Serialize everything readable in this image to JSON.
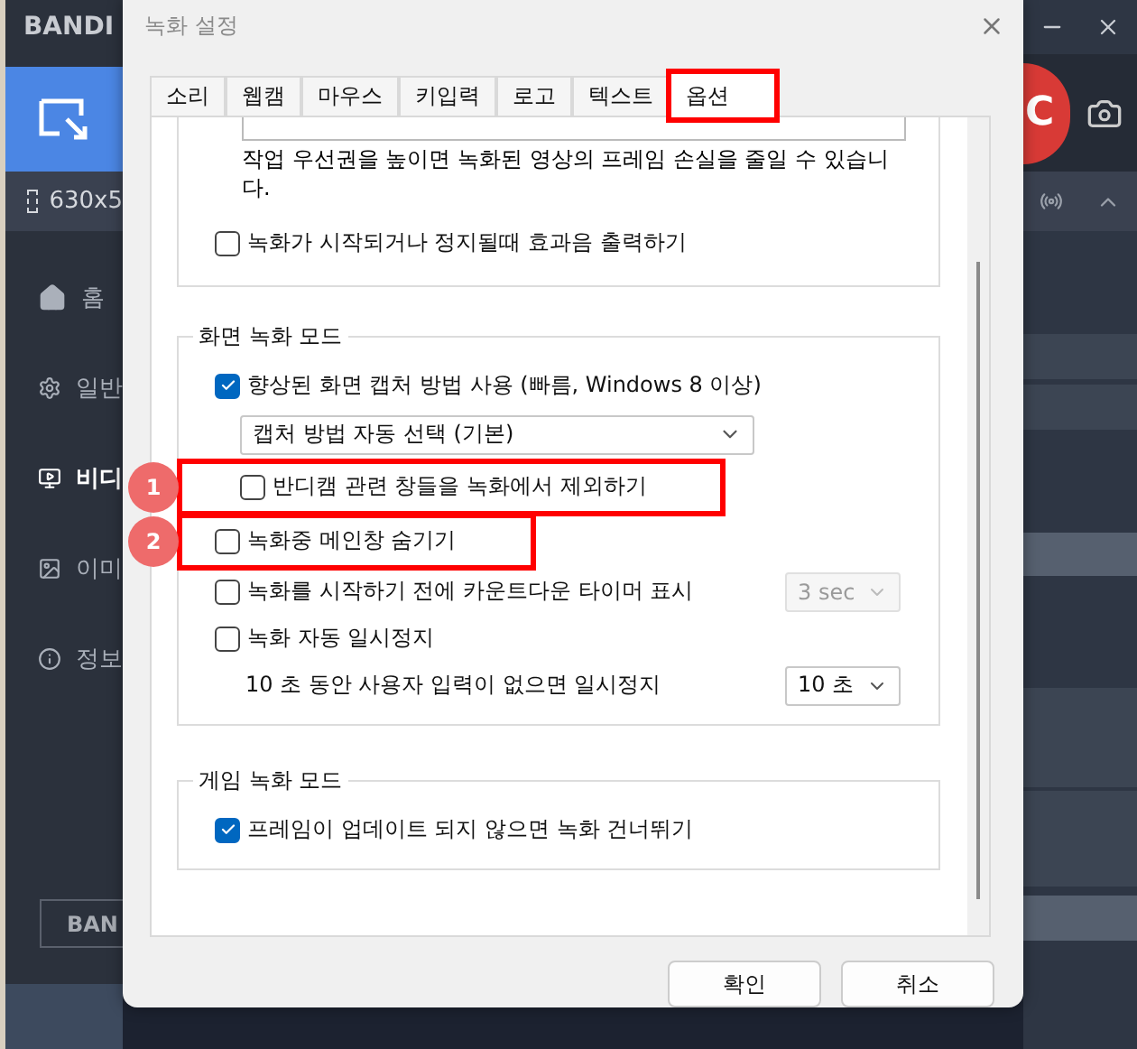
{
  "app": {
    "logo": "BANDI",
    "region": "630x5",
    "record_button": "C",
    "bottom_button": "BAN",
    "sidebar": [
      {
        "label": "홈",
        "kind": "home",
        "selected": false
      },
      {
        "label": "일반",
        "kind": "gear",
        "selected": false
      },
      {
        "label": "비디",
        "kind": "video",
        "selected": true
      },
      {
        "label": "이미",
        "kind": "image",
        "selected": false
      },
      {
        "label": "정보",
        "kind": "info",
        "selected": false
      }
    ]
  },
  "dialog": {
    "title": "녹화 설정",
    "tabs": [
      {
        "label": "소리",
        "selected": false,
        "highlighted": false
      },
      {
        "label": "웹캠",
        "selected": false,
        "highlighted": false
      },
      {
        "label": "마우스",
        "selected": false,
        "highlighted": false
      },
      {
        "label": "키입력",
        "selected": false,
        "highlighted": false
      },
      {
        "label": "로고",
        "selected": false,
        "highlighted": false
      },
      {
        "label": "텍스트",
        "selected": false,
        "highlighted": false
      },
      {
        "label": "옵션",
        "selected": true,
        "highlighted": true
      }
    ],
    "priority_note": "작업 우선권을 높이면 녹화된 영상의 프레임 손실을 줄일 수 있습니다.",
    "sound_effect": {
      "label": "녹화가 시작되거나 정지될때 효과음 출력하기",
      "checked": false
    },
    "groups": [
      {
        "title": "화면 녹화 모드",
        "items": [
          {
            "kind": "checkbox",
            "label": "향상된 화면 캡처 방법 사용 (빠름, Windows 8 이상)",
            "checked": true
          },
          {
            "kind": "select",
            "value": "캡처 방법 자동 선택 (기본)"
          },
          {
            "kind": "sub_checkbox",
            "label": "반디캠 관련 창들을 녹화에서 제외하기",
            "checked": false,
            "callout": "1"
          },
          {
            "kind": "checkbox",
            "label": "녹화중 메인창 숨기기",
            "checked": false,
            "callout": "2"
          },
          {
            "kind": "checkbox",
            "label": "녹화를 시작하기 전에 카운트다운 타이머 표시",
            "checked": false,
            "select": {
              "value": "3 sec",
              "disabled": true
            }
          },
          {
            "kind": "checkbox",
            "label": "녹화 자동 일시정지",
            "checked": false
          },
          {
            "kind": "text",
            "label": "10 초 동안 사용자 입력이 없으면 일시정지",
            "select": {
              "value": "10 초",
              "disabled": false
            }
          }
        ]
      },
      {
        "title": "게임 녹화 모드",
        "items": [
          {
            "kind": "checkbox",
            "label": "프레임이 업데이트 되지 않으면 녹화 건너뛰기",
            "checked": true
          }
        ]
      }
    ],
    "buttons": [
      {
        "label": "확인"
      },
      {
        "label": "취소"
      }
    ]
  }
}
